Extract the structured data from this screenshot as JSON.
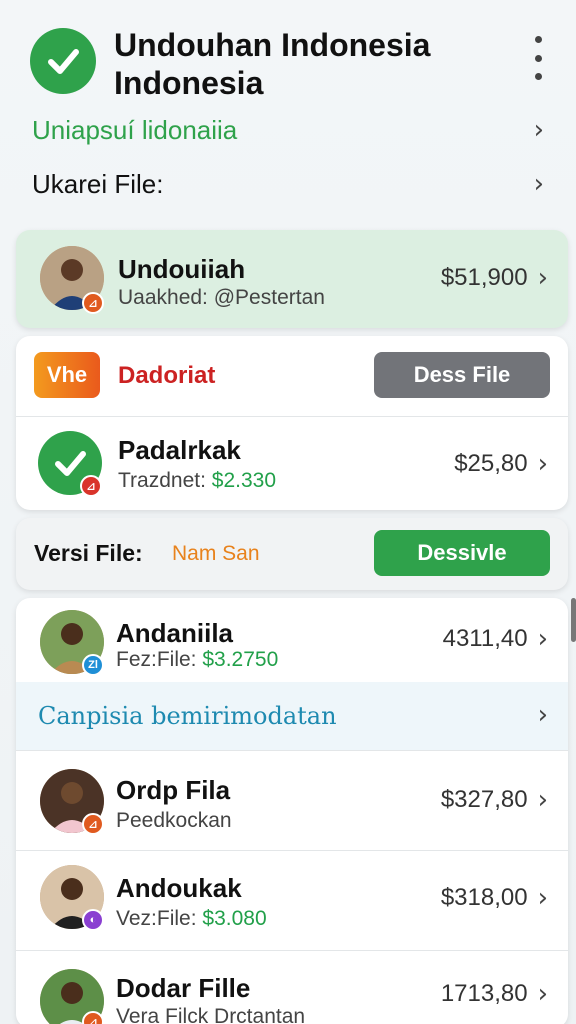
{
  "header": {
    "title": "Undouhan Indonesia Indonesia",
    "link_primary": "Uniapsuí lidonaiia",
    "link_secondary": "Ukarei File:"
  },
  "featured": {
    "name": "Undouiiah",
    "subtitle": "Uaakhed: @Pestertan",
    "amount": "$51,900"
  },
  "promo": {
    "logo_text": "Vhe",
    "label": "Dadoriat",
    "button": "Dess File"
  },
  "item_padalrkak": {
    "name": "Padalrkak",
    "sub_label": "Trazdnet:",
    "sub_value": "$2.330",
    "amount": "$25,80"
  },
  "version_bar": {
    "label": "Versi File:",
    "value": "Nam San",
    "button": "Dessivle"
  },
  "list": {
    "item1": {
      "name": "Andaniila",
      "sub_label": "Fez:File:",
      "sub_value": "$3.2750",
      "amount": "4311,40",
      "badge": "Zl"
    },
    "section_link": "Canpisia bemirimodatan",
    "item2": {
      "name": "Ordp Fila",
      "subtitle": "Peedkockan",
      "amount": "$327,80"
    },
    "item3": {
      "name": "Andoukak",
      "sub_label": "Vez:File:",
      "sub_value": "$3.080",
      "amount": "$318,00"
    },
    "item4": {
      "name": "Dodar Fille",
      "subtitle": "Vera Filck Drctantan",
      "amount": "1713,80"
    }
  },
  "colors": {
    "brand_green": "#2fa24b",
    "featured_bg": "#dcefe1",
    "accent_red": "#cc2222",
    "link_teal": "#1e8ab0",
    "button_gray": "#727479"
  },
  "icons": {
    "app": "check-circle-icon",
    "menu": "kebab-menu-icon",
    "chevron": "chevron-right-icon"
  }
}
